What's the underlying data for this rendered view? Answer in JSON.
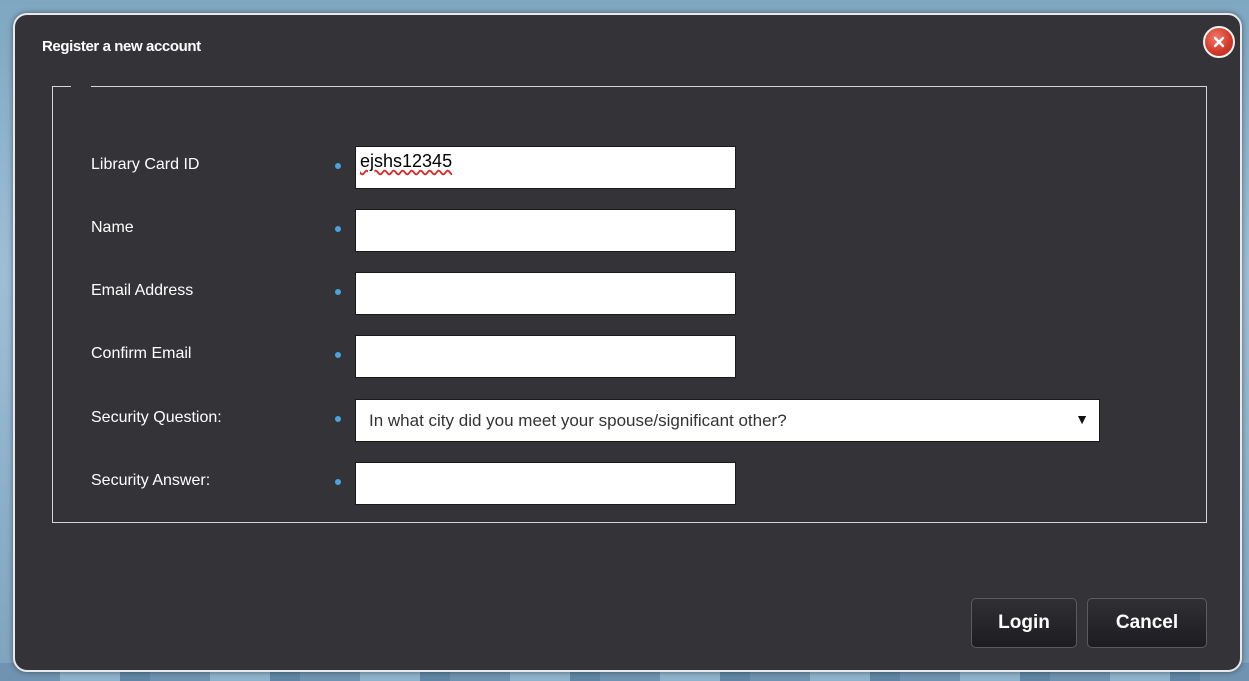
{
  "dialog": {
    "title": "Register a new account"
  },
  "icons": {
    "close": "close-icon"
  },
  "form": {
    "fields": [
      {
        "label": "Library Card ID",
        "value": "ejshs12345",
        "placeholder": ""
      },
      {
        "label": "Name",
        "value": "",
        "placeholder": ""
      },
      {
        "label": "Email Address",
        "value": "",
        "placeholder": ""
      },
      {
        "label": "Confirm Email",
        "value": "",
        "placeholder": ""
      },
      {
        "label": "Security Question:",
        "value": "In what city did you meet your spouse/significant other?"
      },
      {
        "label": "Security Answer:",
        "value": "",
        "placeholder": ""
      }
    ]
  },
  "buttons": {
    "login": "Login",
    "cancel": "Cancel"
  },
  "colors": {
    "dialog_bg": "#333338",
    "required_dot": "#4aa3e0",
    "close_red": "#d43b2b"
  }
}
